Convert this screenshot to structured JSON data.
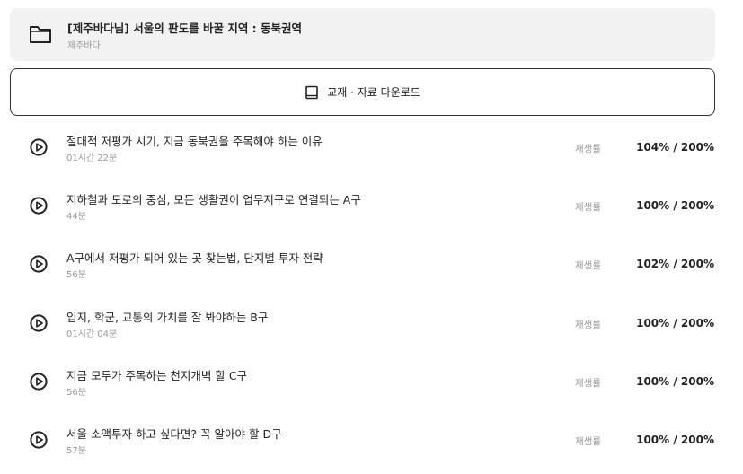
{
  "course": {
    "title": "[제주바다님] 서울의 판도를 바꿀 지역 : 동북권역",
    "author": "제주바다",
    "icon": "folder-icon"
  },
  "download": {
    "label": "교재 · 자료 다운로드",
    "icon": "book-icon"
  },
  "lectures": [
    {
      "title": "절대적 저평가 시기, 지금 동북권을 주목해야 하는 이유",
      "duration": "01시간 22분",
      "rate_label": "재생률",
      "rate": "104% / 200%"
    },
    {
      "title": "지하철과 도로의 중심, 모든 생활권이 업무지구로 연결되는 A구",
      "duration": "44분",
      "rate_label": "재생률",
      "rate": "100% / 200%"
    },
    {
      "title": "A구에서 저평가 되어 있는 곳 찾는법, 단지별 투자 전략",
      "duration": "56분",
      "rate_label": "재생률",
      "rate": "102% / 200%"
    },
    {
      "title": "입지, 학군, 교통의 가치를 잘 봐야하는 B구",
      "duration": "01시간 04분",
      "rate_label": "재생률",
      "rate": "100% / 200%"
    },
    {
      "title": "지금 모두가 주목하는 천지개벽 할 C구",
      "duration": "56분",
      "rate_label": "재생률",
      "rate": "100% / 200%"
    },
    {
      "title": "서울 소액투자 하고 싶다면? 꼭 알아야 할 D구",
      "duration": "57분",
      "rate_label": "재생률",
      "rate": "100% / 200%"
    }
  ],
  "colors": {
    "header_bg": "#f2f2f2",
    "text_primary": "#222222",
    "text_secondary": "#999999"
  }
}
